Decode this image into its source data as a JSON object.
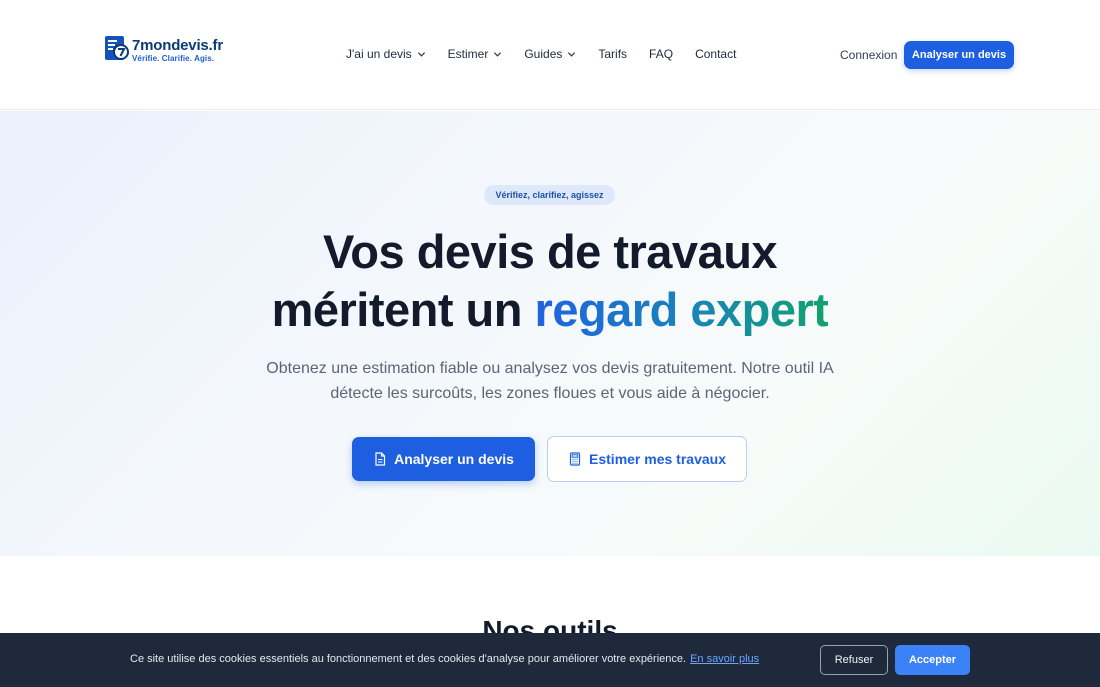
{
  "brand": {
    "name": "7mondevis.fr",
    "tagline": "Vérifie. Clarifie. Agis.",
    "colors": {
      "primary": "#1d5fe0",
      "navy": "#0b3a79",
      "green": "#11a26e",
      "dark": "#1e293b"
    }
  },
  "nav": {
    "items": [
      {
        "label": "J'ai un devis",
        "has_dropdown": true
      },
      {
        "label": "Estimer",
        "has_dropdown": true
      },
      {
        "label": "Guides",
        "has_dropdown": true
      },
      {
        "label": "Tarifs",
        "has_dropdown": false
      },
      {
        "label": "FAQ",
        "has_dropdown": false
      },
      {
        "label": "Contact",
        "has_dropdown": false
      }
    ],
    "login_label": "Connexion",
    "cta_label": "Analyser un devis"
  },
  "hero": {
    "badge": "Vérifiez, clarifiez, agissez",
    "title_line1": "Vos devis de travaux",
    "title_line2_prefix": "méritent un ",
    "title_line2_accent": "regard expert",
    "subtitle": "Obtenez une estimation fiable ou analysez vos devis gratuitement. Notre outil IA détecte les surcoûts, les zones floues et vous aide à négocier.",
    "primary_button": "Analyser un devis",
    "secondary_button": "Estimer mes travaux"
  },
  "tools_section": {
    "title": "Nos outils"
  },
  "cookie_banner": {
    "text": "Ce site utilise des cookies essentiels au fonctionnement et des cookies d'analyse pour améliorer votre expérience.",
    "link_label": "En savoir plus",
    "refuse_label": "Refuser",
    "accept_label": "Accepter"
  },
  "icons": [
    "logo-document-icon",
    "chevron-down-icon",
    "document-icon",
    "calculator-icon"
  ]
}
